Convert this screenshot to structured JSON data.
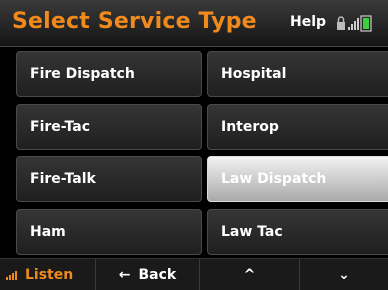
{
  "header": {
    "title": "Select Service Type",
    "help_label": "Help"
  },
  "services": [
    {
      "label": "Fire Dispatch",
      "selected": false
    },
    {
      "label": "Hospital",
      "selected": false
    },
    {
      "label": "Fire-Tac",
      "selected": false
    },
    {
      "label": "Interop",
      "selected": false
    },
    {
      "label": "Fire-Talk",
      "selected": false
    },
    {
      "label": "Law Dispatch",
      "selected": true
    },
    {
      "label": "Ham",
      "selected": false
    },
    {
      "label": "Law Tac",
      "selected": false
    }
  ],
  "footer": {
    "listen_label": "Listen",
    "back_label": "Back",
    "back_icon": "←",
    "up_icon": "^",
    "down_icon": "⌄"
  },
  "colors": {
    "accent": "#f08a1c",
    "status_green": "#3ccf3c"
  },
  "icons": {
    "status": [
      "lock-icon",
      "signal-bars-icon",
      "battery-icon"
    ],
    "footer": [
      "signal-bars-icon",
      "left-arrow-icon",
      "up-arrow-icon",
      "down-arrow-icon"
    ]
  }
}
